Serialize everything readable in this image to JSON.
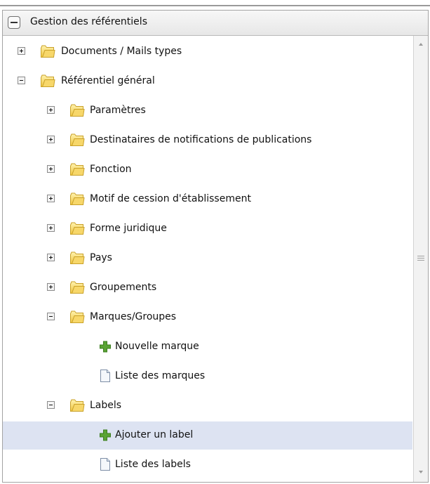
{
  "panel": {
    "title": "Gestion des référentiels"
  },
  "tree": {
    "items": [
      {
        "label": "Documents / Mails types",
        "type": "folder",
        "state": "collapsed"
      },
      {
        "label": "Référentiel général",
        "type": "folder",
        "state": "expanded"
      },
      {
        "label": "Paramètres",
        "type": "folder",
        "state": "collapsed"
      },
      {
        "label": "Destinataires de notifications de publications",
        "type": "folder",
        "state": "collapsed"
      },
      {
        "label": "Fonction",
        "type": "folder",
        "state": "collapsed"
      },
      {
        "label": "Motif de cession d'établissement",
        "type": "folder",
        "state": "collapsed"
      },
      {
        "label": "Forme juridique",
        "type": "folder",
        "state": "collapsed"
      },
      {
        "label": "Pays",
        "type": "folder",
        "state": "collapsed"
      },
      {
        "label": "Groupements",
        "type": "folder",
        "state": "collapsed"
      },
      {
        "label": "Marques/Groupes",
        "type": "folder",
        "state": "expanded"
      },
      {
        "label": "Nouvelle marque",
        "type": "action",
        "icon": "green-plus-icon"
      },
      {
        "label": "Liste des marques",
        "type": "document",
        "icon": "document-icon"
      },
      {
        "label": "Labels",
        "type": "folder",
        "state": "expanded"
      },
      {
        "label": "Ajouter un label",
        "type": "action",
        "icon": "green-plus-icon",
        "selected": true
      },
      {
        "label": "Liste des labels",
        "type": "document",
        "icon": "document-icon"
      }
    ]
  },
  "colors": {
    "selection": "#dde3f2",
    "folder": "#f2cf55",
    "plus": "#4f9a2e"
  }
}
